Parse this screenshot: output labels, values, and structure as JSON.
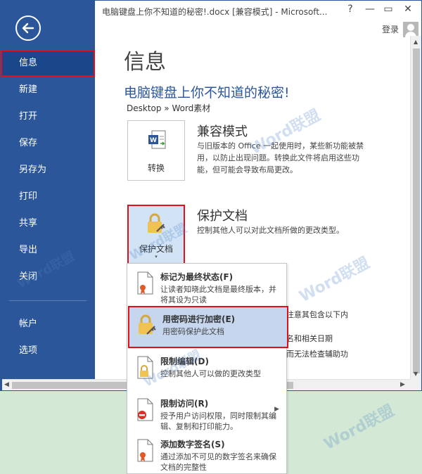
{
  "window": {
    "title": "电脑键盘上你不知道的秘密!.docx [兼容模式] - Microsoft...",
    "help": "?",
    "minimize": "—",
    "restore": "▭",
    "close": "✕",
    "signin": "登录"
  },
  "sidebar": {
    "back_icon": "arrow-left-circle-icon",
    "items": [
      {
        "label": "信息"
      },
      {
        "label": "新建"
      },
      {
        "label": "打开"
      },
      {
        "label": "保存"
      },
      {
        "label": "另存为"
      },
      {
        "label": "打印"
      },
      {
        "label": "共享"
      },
      {
        "label": "导出"
      },
      {
        "label": "关闭"
      }
    ],
    "bottom_items": [
      {
        "label": "帐户"
      },
      {
        "label": "选项"
      }
    ]
  },
  "main": {
    "page_title": "信息",
    "doc_title": "电脑键盘上你不知道的秘密!",
    "breadcrumb": "Desktop » Word素材",
    "compat": {
      "button_label": "转换",
      "heading": "兼容模式",
      "desc": "与旧版本的 Office 一起使用时，某些新功能被禁用，以防止出现问题。转换此文件将启用这些功能，但可能会导致布局更改。"
    },
    "protect": {
      "button_label": "保护文档",
      "heading": "保护文档",
      "desc": "控制其他人可以对此文档所做的更改类型。"
    },
    "partial_lines": [
      "注意其包含以下内",
      "名和相关日期",
      "而无法检查辅助功"
    ]
  },
  "menu": {
    "items": [
      {
        "title": "标记为最终状态(F)",
        "desc": "让读者知晓此文档是最终版本，并将其设为只读"
      },
      {
        "title": "用密码进行加密(E)",
        "desc": "用密码保护此文档"
      },
      {
        "title": "限制编辑(D)",
        "desc": "控制其他人可以做的更改类型"
      },
      {
        "title": "限制访问(R)",
        "desc": "授予用户访问权限，同时限制其编辑、复制和打印能力。"
      },
      {
        "title": "添加数字签名(S)",
        "desc": "通过添加不可见的数字签名来确保文档的完整性"
      }
    ]
  },
  "watermark": {
    "text": "Word联盟"
  },
  "colors": {
    "sidebar": "#2b579a",
    "accent_title": "#2b579a",
    "highlight_border": "#e0101b",
    "menu_highlight": "#c5d6ee",
    "outer_background": "#d3e9d6"
  }
}
